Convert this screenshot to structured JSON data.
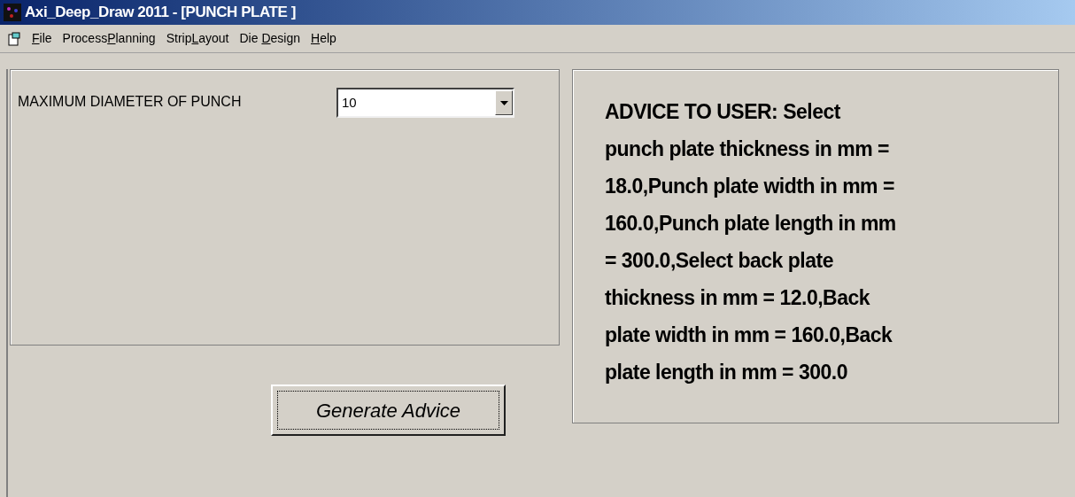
{
  "window": {
    "title": "Axi_Deep_Draw 2011 - [PUNCH PLATE ]"
  },
  "menu": [
    {
      "key": "F",
      "after": "ile"
    },
    {
      "before": "Process",
      "key": "P",
      "after": "lanning"
    },
    {
      "before": "Strip",
      "key": "L",
      "after": "ayout"
    },
    {
      "before": "Die ",
      "key": "D",
      "after": "esign"
    },
    {
      "key": "H",
      "after": "elp"
    }
  ],
  "input_panel": {
    "label": "MAXIMUM DIAMETER OF PUNCH",
    "value": "10"
  },
  "button": "Generate Advice",
  "advice": {
    "lines": [
      "ADVICE TO USER: Select",
      "punch plate thickness in mm =",
      "18.0,Punch plate width in mm =",
      "160.0,Punch plate length in mm",
      "= 300.0,Select back plate",
      "thickness in mm = 12.0,Back",
      "plate width in mm = 160.0,Back",
      "plate length in mm = 300.0"
    ]
  }
}
